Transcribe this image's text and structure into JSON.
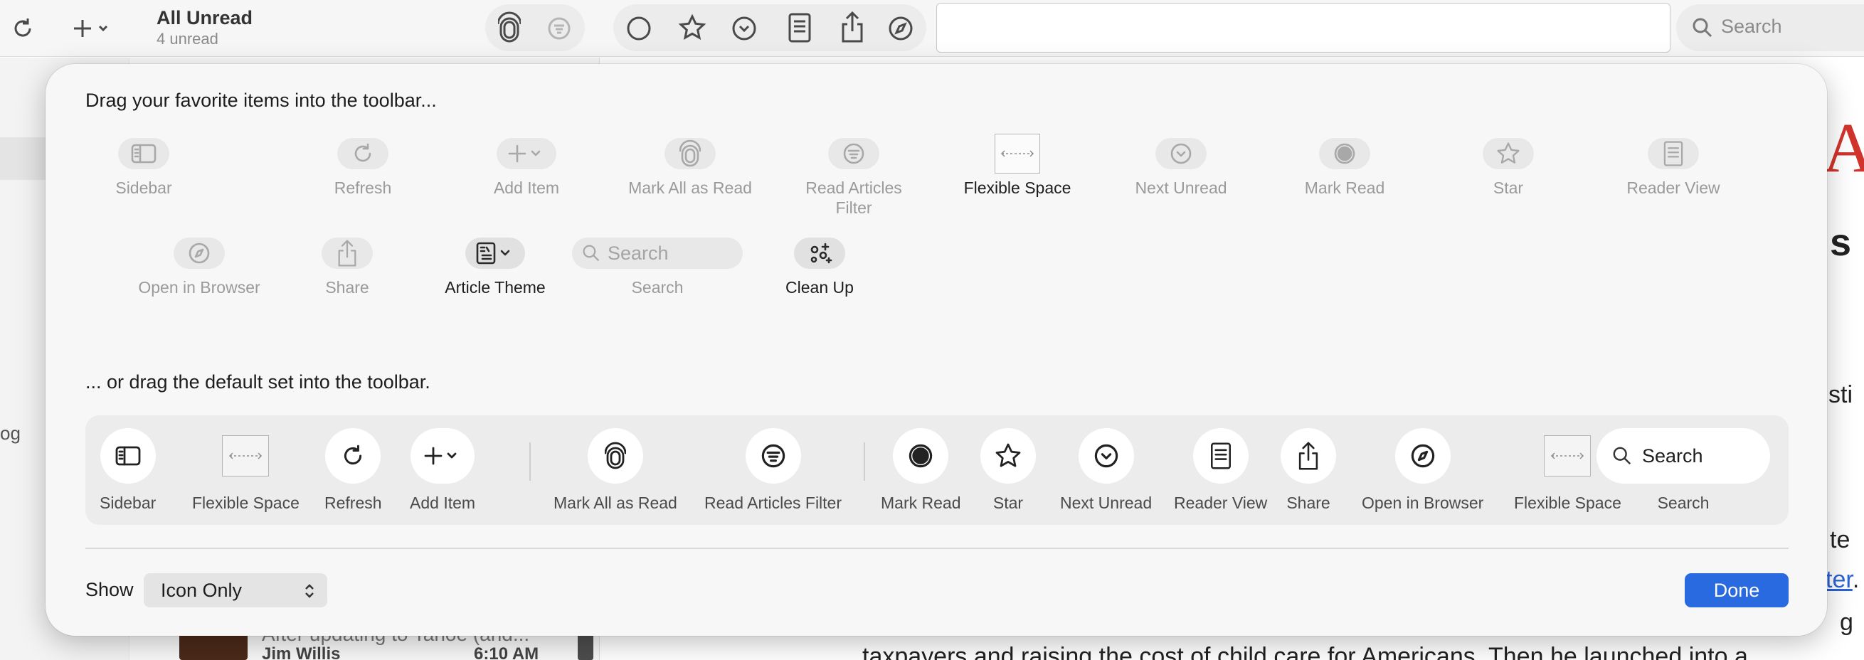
{
  "app": {
    "list_title": "All Unread",
    "list_subtitle": "4 unread",
    "search_label": "Search",
    "background_snippets": {
      "right_fragment_1": "s",
      "right_fragment_2": "sti",
      "right_fragment_3": "te",
      "right_link_fragment": "ter",
      "right_period": ".",
      "sidebar_fragment": "og",
      "list_preview": "After updating to Tahoe (and...",
      "list_author": "Jim Willis",
      "list_time": "6:10 AM",
      "body_line": "taxpayers and raising the cost of child care for Americans. Then he launched into a",
      "right_ghost": "g",
      "masthead_letter": "A"
    }
  },
  "customize": {
    "drag_items_heading": "Drag your favorite items into the toolbar...",
    "drag_default_heading": "... or drag the default set into the toolbar.",
    "items": [
      {
        "label": "Sidebar",
        "icon": "sidebar-icon"
      },
      {
        "label": "Refresh",
        "icon": "refresh-icon"
      },
      {
        "label": "Add Item",
        "icon": "plus-chevron-icon"
      },
      {
        "label": "Mark All as Read",
        "icon": "mark-all-read-icon"
      },
      {
        "label": "Read Articles Filter",
        "icon": "filter-icon"
      },
      {
        "label": "Flexible Space",
        "icon": "flexible-space-icon"
      },
      {
        "label": "Next Unread",
        "icon": "next-unread-icon"
      },
      {
        "label": "Mark Read",
        "icon": "mark-read-icon"
      },
      {
        "label": "Star",
        "icon": "star-icon"
      },
      {
        "label": "Reader View",
        "icon": "reader-view-icon"
      },
      {
        "label": "Open in Browser",
        "icon": "compass-icon"
      },
      {
        "label": "Share",
        "icon": "share-icon"
      },
      {
        "label": "Article Theme",
        "icon": "article-theme-icon"
      },
      {
        "label": "Search",
        "icon": "search-icon",
        "placeholder": "Search"
      },
      {
        "label": "Clean Up",
        "icon": "clean-up-icon"
      }
    ],
    "default_set": [
      {
        "label": "Sidebar"
      },
      {
        "label": "Flexible Space"
      },
      {
        "label": "Refresh"
      },
      {
        "label": "Add Item"
      },
      {
        "label": "Mark All as Read"
      },
      {
        "label": "Read Articles Filter"
      },
      {
        "label": "Mark Read"
      },
      {
        "label": "Star"
      },
      {
        "label": "Next Unread"
      },
      {
        "label": "Reader View"
      },
      {
        "label": "Share"
      },
      {
        "label": "Open in Browser"
      },
      {
        "label": "Flexible Space"
      },
      {
        "label": "Search",
        "placeholder": "Search"
      }
    ],
    "show_label": "Show",
    "show_value": "Icon Only",
    "done_label": "Done"
  },
  "colors": {
    "accent": "#2a6ae0",
    "masthead_red": "#d0342c",
    "link_blue": "#2a62d6"
  }
}
